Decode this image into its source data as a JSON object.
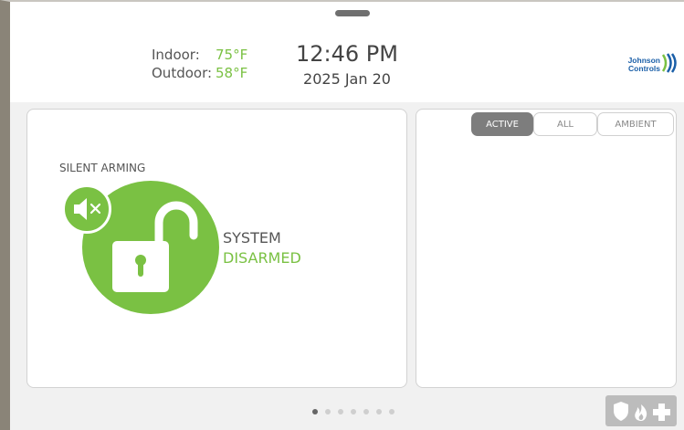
{
  "header": {
    "indoor_label": "Indoor:",
    "indoor_temp": "75°F",
    "outdoor_label": "Outdoor:",
    "outdoor_temp": "58°F",
    "time": "12:46 PM",
    "date": "2025 Jan 20",
    "logo_text_line1": "Johnson",
    "logo_text_line2": "Controls"
  },
  "security": {
    "silent_label": "SILENT ARMING",
    "status_line1": "SYSTEM",
    "status_line2": "DISARMED",
    "lock_icon": "unlocked-padlock-icon",
    "mute_icon": "speaker-muted-icon"
  },
  "sensors": {
    "tabs": [
      {
        "label": "ACTIVE",
        "selected": true
      },
      {
        "label": "ALL",
        "selected": false
      },
      {
        "label": "AMBIENT",
        "selected": false
      }
    ]
  },
  "pager": {
    "count": 7,
    "current": 1
  },
  "emergency": {
    "icons": [
      "shield-icon",
      "fire-icon",
      "medical-cross-icon"
    ]
  },
  "colors": {
    "accent_green": "#7ac143",
    "tab_active": "#7d7d7d",
    "logo_blue": "#1a5fa8"
  }
}
